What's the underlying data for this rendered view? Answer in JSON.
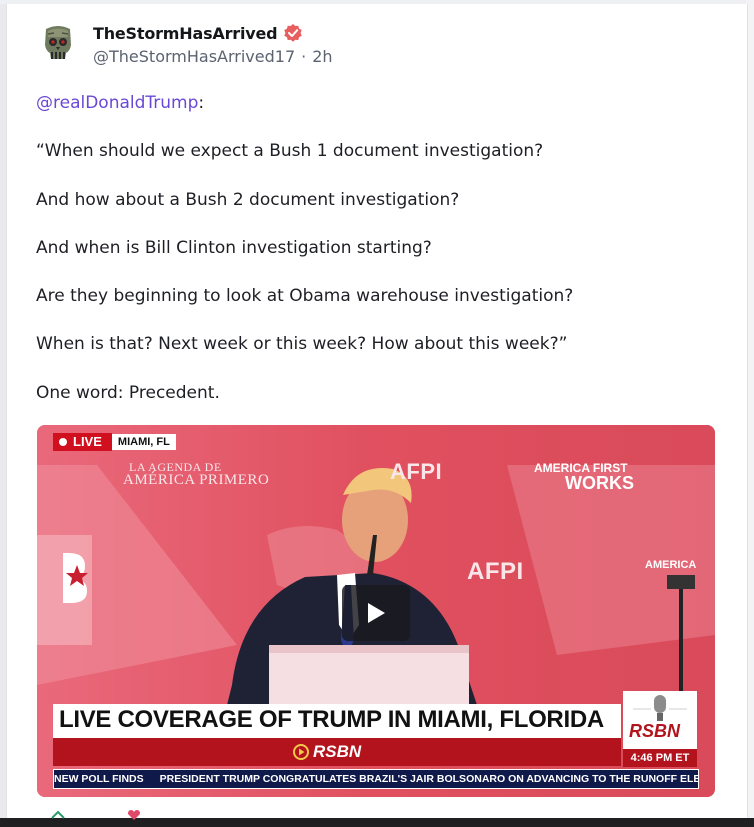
{
  "post": {
    "display_name": "TheStormHasArrived",
    "handle": "@TheStormHasArrived17",
    "separator": "·",
    "time": "2h",
    "verified_color": "#e85d5d",
    "mention": "@realDonaldTrump",
    "mention_suffix": ":",
    "lines": [
      "“When should we expect a Bush 1 document investigation?",
      "And how about a Bush 2 document investigation?",
      "And when is Bill Clinton investigation starting?",
      "Are they beginning to look at Obama warehouse investigation?",
      "When is that? Next week or this week? How about this week?”",
      "One word: Precedent."
    ]
  },
  "video": {
    "live_label": "LIVE",
    "location": "MIAMI, FL",
    "sign_line1": "LA AGENDA DE",
    "sign_line2": "AMÉRICA PRIMERO",
    "afpi": "AFPI",
    "afw_line1": "AMERICA FIRST",
    "afw_line2": "WORKS",
    "sign_right": "AMERICA",
    "headline": "LIVE COVERAGE OF TRUMP IN MIAMI, FLORIDA",
    "network": "RSBN",
    "time": "4:46 PM  ET",
    "ticker_1": "NEW POLL FINDS",
    "ticker_2": "PRESIDENT TRUMP CONGRATULATES BRAZIL'S JAIR BOLSONARO ON ADVANCING TO THE RUNOFF ELECTION",
    "play_icon": "play-icon"
  }
}
